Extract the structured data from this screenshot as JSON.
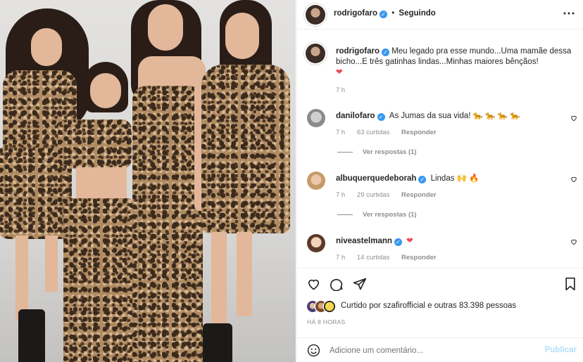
{
  "post": {
    "author": "rodrigofaro",
    "follow_status": "Seguindo",
    "separator": "•",
    "caption_text": "Meu legado pra esse mundo...Uma mamãe dessa bicho...E três gatinhas lindas...Minhas maiores bênçãos!",
    "caption_emoji": "❤",
    "caption_time": "7 h",
    "more_icon": "⋯"
  },
  "comments": [
    {
      "user": "danilofaro",
      "text": "As Jumas da sua vida! 🐆 🐆 🐆 🐆",
      "time": "7 h",
      "likes": "63 curtidas",
      "reply": "Responder",
      "view_replies": "Ver respostas (1)"
    },
    {
      "user": "albuquerquedeborah",
      "text": "Lindas 🙌 🔥",
      "time": "7 h",
      "likes": "29 curtidas",
      "reply": "Responder",
      "view_replies": "Ver respostas (1)"
    },
    {
      "user": "niveastelmann",
      "text": "❤",
      "time": "7 h",
      "likes": "14 curtidas",
      "reply": "Responder"
    }
  ],
  "actions": {
    "like_icon": "heart-icon",
    "comment_icon": "comment-icon",
    "share_icon": "share-icon",
    "save_icon": "bookmark-icon"
  },
  "likes": {
    "prefix": "Curtido por",
    "user": "szafirofficial",
    "suffix": "e outras",
    "count": "83.398",
    "unit": "pessoas"
  },
  "post_time": "HÁ 8 HORAS",
  "add_comment": {
    "placeholder": "Adicione um comentário...",
    "publish": "Publicar"
  },
  "colors": {
    "verified": "#3897f0",
    "heart": "#ed4956",
    "publish_disabled": "#b2dffc",
    "muted": "#8e8e8e"
  }
}
